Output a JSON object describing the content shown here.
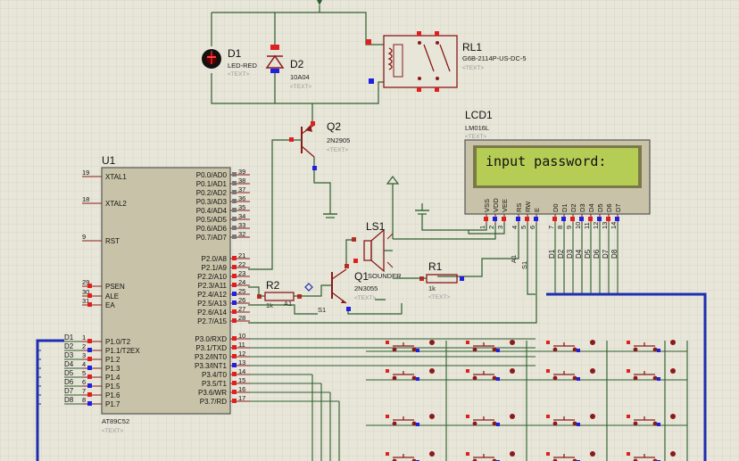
{
  "colors": {
    "background": "#e7e6d9",
    "grid": "#d3d2c2",
    "wire": "#2e5f2e",
    "outline": "#8b1a1a",
    "chip_fill": "#c8c3a8",
    "lcd_screen": "#b5cc55",
    "bus": "#1d2eb0",
    "pin_red": "#e02020",
    "pin_blue": "#2020e0"
  },
  "mcu": {
    "ref": "U1",
    "part": "AT89C52",
    "text": "<TEXT>",
    "left_pins": [
      {
        "num": "19",
        "name": "XTAL1"
      },
      {
        "num": "18",
        "name": "XTAL2"
      },
      {
        "num": "9",
        "name": "RST"
      },
      {
        "num": "29",
        "name": "PSEN"
      },
      {
        "num": "30",
        "name": "ALE"
      },
      {
        "num": "31",
        "name": "EA"
      },
      {
        "num": "1",
        "name": "P1.0/T2"
      },
      {
        "num": "2",
        "name": "P1.1/T2EX"
      },
      {
        "num": "3",
        "name": "P1.2"
      },
      {
        "num": "4",
        "name": "P1.3"
      },
      {
        "num": "5",
        "name": "P1.4"
      },
      {
        "num": "6",
        "name": "P1.5"
      },
      {
        "num": "7",
        "name": "P1.6"
      },
      {
        "num": "8",
        "name": "P1.7"
      }
    ],
    "right_pins": [
      {
        "num": "39",
        "name": "P0.0/AD0"
      },
      {
        "num": "38",
        "name": "P0.1/AD1"
      },
      {
        "num": "37",
        "name": "P0.2/AD2"
      },
      {
        "num": "36",
        "name": "P0.3/AD3"
      },
      {
        "num": "35",
        "name": "P0.4/AD4"
      },
      {
        "num": "34",
        "name": "P0.5/AD5"
      },
      {
        "num": "33",
        "name": "P0.6/AD6"
      },
      {
        "num": "32",
        "name": "P0.7/AD7"
      },
      {
        "num": "21",
        "name": "P2.0/A8"
      },
      {
        "num": "22",
        "name": "P2.1/A9"
      },
      {
        "num": "23",
        "name": "P2.2/A10"
      },
      {
        "num": "24",
        "name": "P2.3/A11"
      },
      {
        "num": "25",
        "name": "P2.4/A12"
      },
      {
        "num": "26",
        "name": "P2.5/A13"
      },
      {
        "num": "27",
        "name": "P2.6/A14"
      },
      {
        "num": "28",
        "name": "P2.7/A15"
      },
      {
        "num": "10",
        "name": "P3.0/RXD"
      },
      {
        "num": "11",
        "name": "P3.1/TXD"
      },
      {
        "num": "12",
        "name": "P3.2/INT0"
      },
      {
        "num": "13",
        "name": "P3.3/INT1"
      },
      {
        "num": "14",
        "name": "P3.4/T0"
      },
      {
        "num": "15",
        "name": "P3.5/T1"
      },
      {
        "num": "16",
        "name": "P3.6/WR"
      },
      {
        "num": "17",
        "name": "P3.7/RD"
      }
    ],
    "net_labels": [
      "D1",
      "D2",
      "D3",
      "D4",
      "D5",
      "D6",
      "D7",
      "D8"
    ]
  },
  "lcd": {
    "ref": "LCD1",
    "part": "LM016L",
    "text": "<TEXT>",
    "display": "input password:",
    "pins": [
      {
        "num": "1",
        "name": "VSS"
      },
      {
        "num": "2",
        "name": "VDD"
      },
      {
        "num": "3",
        "name": "VEE"
      },
      {
        "num": "4",
        "name": "RS"
      },
      {
        "num": "5",
        "name": "RW"
      },
      {
        "num": "6",
        "name": "E"
      },
      {
        "num": "7",
        "name": "D0"
      },
      {
        "num": "8",
        "name": "D1"
      },
      {
        "num": "9",
        "name": "D2"
      },
      {
        "num": "10",
        "name": "D3"
      },
      {
        "num": "11",
        "name": "D4"
      },
      {
        "num": "12",
        "name": "D5"
      },
      {
        "num": "13",
        "name": "D6"
      },
      {
        "num": "14",
        "name": "D7"
      }
    ],
    "bus_labels": [
      "D1",
      "D2",
      "D3",
      "D4",
      "D5",
      "D6",
      "D7",
      "D8"
    ],
    "side_labels": [
      "A1",
      "S1"
    ]
  },
  "parts": {
    "d1": {
      "ref": "D1",
      "part": "LED-RED",
      "text": "<TEXT>"
    },
    "d2": {
      "ref": "D2",
      "part": "10A04",
      "text": "<TEXT>"
    },
    "rl1": {
      "ref": "RL1",
      "part": "G6B-2114P-US-DC-5",
      "text": "<TEXT>"
    },
    "q2": {
      "ref": "Q2",
      "part": "2N2905",
      "text": "<TEXT>"
    },
    "q1": {
      "ref": "Q1",
      "part": "2N3055",
      "text": "<TEXT>"
    },
    "ls1": {
      "ref": "LS1",
      "part": "SOUNDER"
    },
    "r1": {
      "ref": "R1",
      "part": "1k",
      "text": "<TEXT>"
    },
    "r2": {
      "ref": "R2",
      "part": "1k",
      "text": "A1"
    },
    "s1": {
      "ref": "S1"
    }
  }
}
